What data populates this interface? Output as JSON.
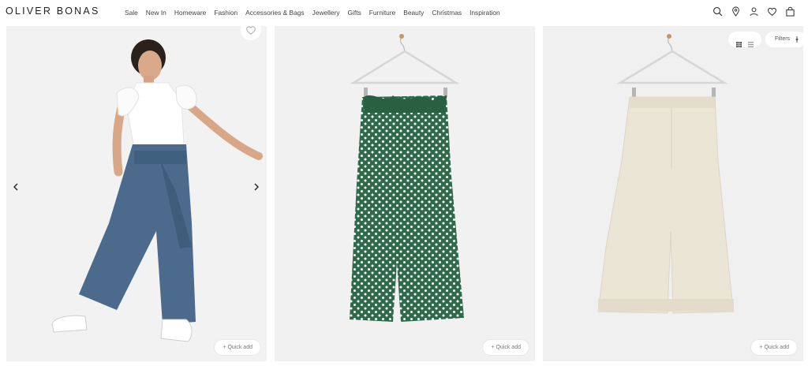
{
  "brand": {
    "logo_text": "OLIVER BONAS"
  },
  "nav": {
    "items": [
      "Sale",
      "New In",
      "Homeware",
      "Fashion",
      "Accessories & Bags",
      "Jewellery",
      "Gifts",
      "Furniture",
      "Beauty",
      "Christmas",
      "Inspiration"
    ]
  },
  "header_icons": [
    "search-icon",
    "location-pin-icon",
    "account-icon",
    "wishlist-heart-icon",
    "shopping-bag-icon"
  ],
  "toolbar": {
    "view_toggle_icons": [
      "grid-view-icon",
      "list-view-icon"
    ],
    "filters_label": "Filters",
    "filters_icon": "filter-toggle-icon"
  },
  "products": [
    {
      "quick_add_label": "+ Quick add",
      "image_desc": "model-wearing-blue-paperbag-trousers",
      "colors": {
        "trouser": "#4b6a8c",
        "top": "#ffffff"
      }
    },
    {
      "quick_add_label": "+ Quick add",
      "image_desc": "green-polka-dot-trousers-on-hanger",
      "colors": {
        "trouser": "#2f6b4a",
        "dots": "#ffffff"
      }
    },
    {
      "quick_add_label": "+ Quick add",
      "image_desc": "cream-wide-leg-trousers-on-hanger",
      "colors": {
        "trouser": "#ebe5d6"
      }
    }
  ],
  "colors": {
    "page_bg": "#ffffff",
    "card_bg": "#f1f1f1",
    "text": "#222222"
  }
}
